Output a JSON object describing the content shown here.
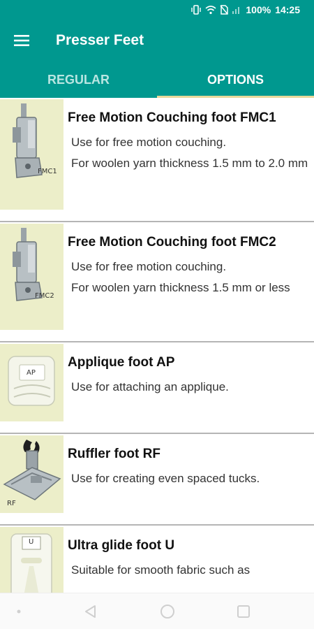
{
  "status": {
    "battery": "100%",
    "time": "14:25"
  },
  "header": {
    "title": "Presser Feet"
  },
  "tabs": [
    {
      "label": "REGULAR"
    },
    {
      "label": "OPTIONS"
    }
  ],
  "items": [
    {
      "title": "Free Motion Couching foot FMC1",
      "code": "FMC1",
      "description": "Use for free motion couching.\nFor woolen yarn thickness 1.5 mm to 2.0 mm"
    },
    {
      "title": "Free Motion Couching foot FMC2",
      "code": "FMC2",
      "description": "Use for free motion couching.\nFor woolen yarn thickness 1.5 mm or less"
    },
    {
      "title": "Applique foot AP",
      "code": "AP",
      "description": "Use for attaching an applique."
    },
    {
      "title": "Ruffler foot RF",
      "code": "RF",
      "description": "Use for creating even spaced tucks."
    },
    {
      "title": "Ultra glide foot U",
      "code": "U",
      "description": "Suitable for smooth fabric such as"
    }
  ],
  "colors": {
    "primary": "#00988f",
    "tab_indicator": "#e8d89a",
    "thumb_bg": "#eceec9"
  }
}
